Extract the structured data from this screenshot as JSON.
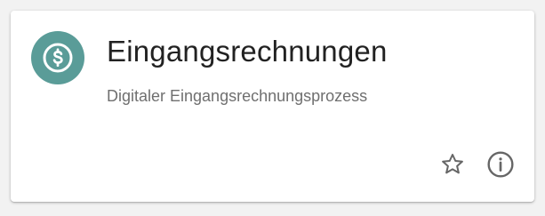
{
  "card": {
    "title": "Eingangsrechnungen",
    "subtitle": "Digitaler Eingangsrechnungsprozess",
    "avatar_icon": "dollar-circle-icon",
    "avatar_color": "#5a9c98",
    "actions": [
      {
        "icon": "star-outline-icon"
      },
      {
        "icon": "info-outline-icon"
      }
    ],
    "icon_color": "#666666"
  }
}
